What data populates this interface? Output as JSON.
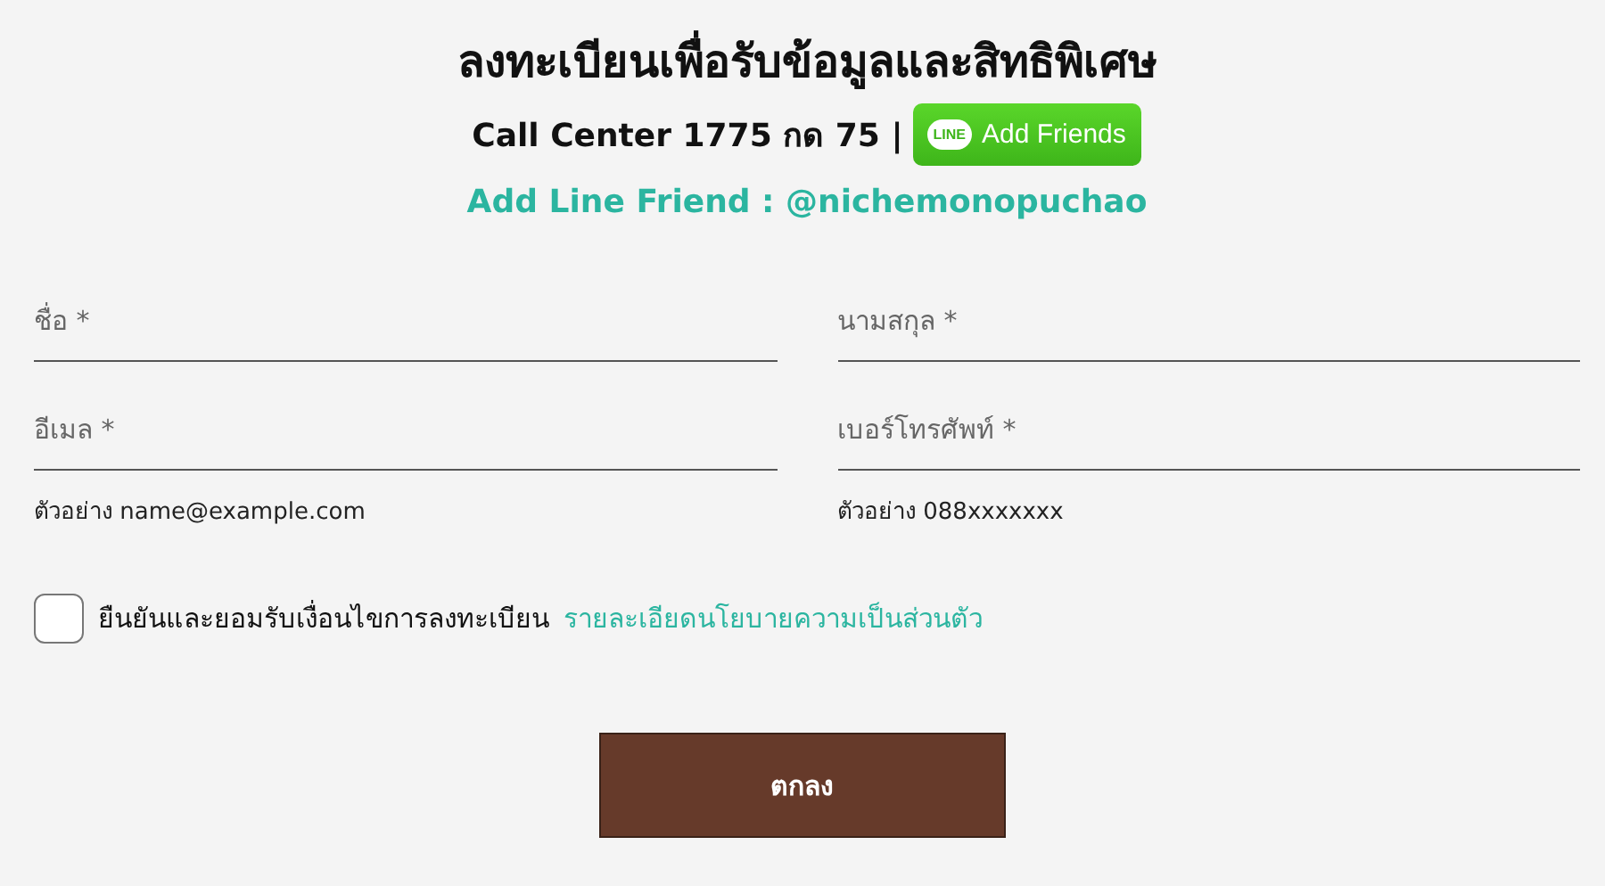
{
  "title": "ลงทะเบียนเพื่อรับข้อมูลและสิทธิพิเศษ",
  "call_center": "Call Center 1775 กด 75 |",
  "line_button": {
    "logo": "LINE",
    "label": "Add Friends"
  },
  "line_friend": "Add Line Friend : @nichemonopuchao",
  "fields": [
    {
      "placeholder": "ชื่อ *"
    },
    {
      "placeholder": "นามสกุล *"
    },
    {
      "placeholder": "อีเมล *",
      "hint": "ตัวอย่าง name@example.com"
    },
    {
      "placeholder": "เบอร์โทรศัพท์ *",
      "hint": "ตัวอย่าง 088xxxxxxx"
    }
  ],
  "consent": {
    "checked": false,
    "text": "ยืนยันและยอมรับเงื่อนไขการลงทะเบียน",
    "link": "รายละเอียดนโยบายความเป็นส่วนตัว"
  },
  "submit": "ตกลง"
}
